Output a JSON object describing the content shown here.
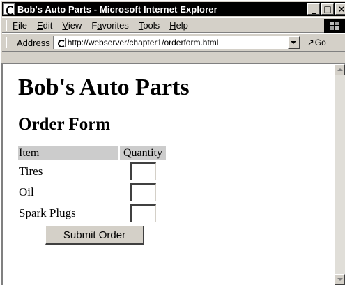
{
  "window": {
    "title": "Bob's Auto Parts - Microsoft Internet Explorer",
    "controls": {
      "minimize": "_",
      "maximize": "□",
      "close": "×"
    }
  },
  "menubar": {
    "items": [
      {
        "pre": "",
        "u": "F",
        "post": "ile"
      },
      {
        "pre": "",
        "u": "E",
        "post": "dit"
      },
      {
        "pre": "",
        "u": "V",
        "post": "iew"
      },
      {
        "pre": "F",
        "u": "a",
        "post": "vorites"
      },
      {
        "pre": "",
        "u": "T",
        "post": "ools"
      },
      {
        "pre": "",
        "u": "H",
        "post": "elp"
      }
    ]
  },
  "addressbar": {
    "label_pre": "A",
    "label_u": "d",
    "label_post": "dress",
    "url": "http://webserver/chapter1/orderform.html",
    "go_label": "Go"
  },
  "page": {
    "heading": "Bob's Auto Parts",
    "subheading": "Order Form",
    "table": {
      "headers": {
        "item": "Item",
        "quantity": "Quantity"
      },
      "rows": [
        {
          "item": "Tires",
          "quantity": ""
        },
        {
          "item": "Oil",
          "quantity": ""
        },
        {
          "item": "Spark Plugs",
          "quantity": ""
        }
      ]
    },
    "submit_label": "Submit Order"
  },
  "icons": {
    "app": "ie-logo-icon",
    "page": "page-icon",
    "go": "go-arrow-icon",
    "throbber": "windows-logo-icon"
  }
}
